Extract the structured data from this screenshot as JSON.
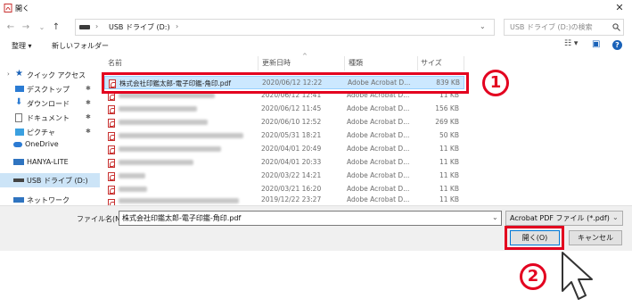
{
  "window": {
    "title": "開く",
    "close_glyph": "✕"
  },
  "nav": {
    "back": "←",
    "forward": "→",
    "recent": "⌄",
    "up": "↑"
  },
  "address": {
    "path": "USB ドライブ (D:)",
    "sep1": "›",
    "sep2": "›",
    "chev": "⌄"
  },
  "search": {
    "placeholder": "USB ドライブ (D:)の検索",
    "icon": "search-icon"
  },
  "toolbar": {
    "organize": "整理 ▾",
    "new_folder": "新しいフォルダー",
    "view": "☷ ▾",
    "pane": "▣",
    "help": "?"
  },
  "sidebar": {
    "items": [
      {
        "label": "クイック アクセス",
        "icon": "star-icon",
        "pinned": false
      },
      {
        "label": "デスクトップ",
        "icon": "desktop-icon",
        "pinned": true
      },
      {
        "label": "ダウンロード",
        "icon": "download-icon",
        "pinned": true
      },
      {
        "label": "ドキュメント",
        "icon": "document-icon",
        "pinned": true
      },
      {
        "label": "ピクチャ",
        "icon": "picture-icon",
        "pinned": true
      },
      {
        "label": "OneDrive",
        "icon": "cloud-icon",
        "pinned": false
      },
      {
        "label": "HANYA-LITE",
        "icon": "computer-icon",
        "pinned": false
      },
      {
        "label": "USB ドライブ (D:)",
        "icon": "usb-drive-icon",
        "pinned": false
      },
      {
        "label": "ネットワーク",
        "icon": "network-icon",
        "pinned": false
      }
    ],
    "pin_glyph": "✱"
  },
  "columns": {
    "name": "名前",
    "modified": "更新日時",
    "type": "種類",
    "size": "サイズ",
    "sort_arrow": "^"
  },
  "files": [
    {
      "name": "株式会社印鑑太郎-電子印鑑-角印.pdf",
      "date": "2020/06/12 12:22",
      "type": "Adobe Acrobat D...",
      "size": "839 KB",
      "selected": true
    },
    {
      "name": "",
      "date": "2020/06/12 12:41",
      "type": "Adobe Acrobat D...",
      "size": "11 KB",
      "selected": false
    },
    {
      "name": "",
      "date": "2020/06/12 11:45",
      "type": "Adobe Acrobat D...",
      "size": "156 KB",
      "selected": false
    },
    {
      "name": "",
      "date": "2020/06/10 12:52",
      "type": "Adobe Acrobat D...",
      "size": "269 KB",
      "selected": false
    },
    {
      "name": "",
      "date": "2020/05/31 18:21",
      "type": "Adobe Acrobat D...",
      "size": "50 KB",
      "selected": false
    },
    {
      "name": "",
      "date": "2020/04/01 20:49",
      "type": "Adobe Acrobat D...",
      "size": "11 KB",
      "selected": false
    },
    {
      "name": "",
      "date": "2020/04/01 20:33",
      "type": "Adobe Acrobat D...",
      "size": "11 KB",
      "selected": false
    },
    {
      "name": "",
      "date": "2020/03/22 14:21",
      "type": "Adobe Acrobat D...",
      "size": "11 KB",
      "selected": false
    },
    {
      "name": "",
      "date": "2020/03/21 16:20",
      "type": "Adobe Acrobat D...",
      "size": "11 KB",
      "selected": false
    },
    {
      "name": "",
      "date": "2019/12/22 23:27",
      "type": "Adobe Acrobat D...",
      "size": "11 KB",
      "selected": false
    }
  ],
  "bottom": {
    "filename_label": "ファイル名(N):",
    "filename_value": "株式会社印鑑太郎-電子印鑑-角印.pdf",
    "filetype_value": "Acrobat PDF ファイル (*.pdf)",
    "chev": "⌄",
    "open_label": "開く(O)",
    "cancel_label": "キャンセル"
  },
  "annotations": {
    "step1": "1",
    "step2": "2"
  },
  "colors": {
    "highlight": "#e3001f",
    "selected_row": "#cce8ff",
    "accent": "#0078d7"
  }
}
